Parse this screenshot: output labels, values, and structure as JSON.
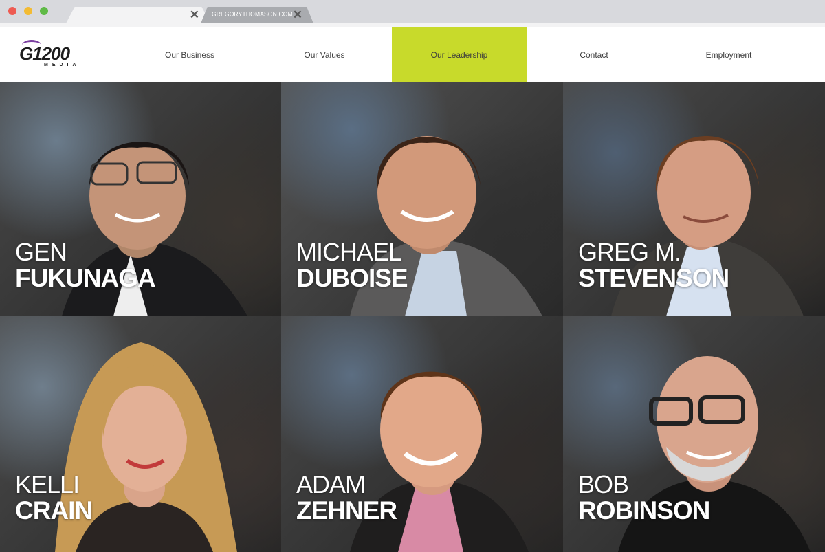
{
  "browser": {
    "active_tab_close": "✕",
    "inactive_tab_title": "GREGORYTHOMASON.COM",
    "inactive_tab_close": "✕"
  },
  "logo": {
    "main": "G1200",
    "sub": "MEDIA"
  },
  "nav": {
    "items": [
      {
        "label": "Our Business",
        "active": false
      },
      {
        "label": "Our Values",
        "active": false
      },
      {
        "label": "Our Leadership",
        "active": true
      },
      {
        "label": "Contact",
        "active": false
      },
      {
        "label": "Employment",
        "active": false
      }
    ],
    "accent_color": "#c8da2b"
  },
  "leaders": [
    {
      "first": "GEN",
      "last": "FUKUNAGA"
    },
    {
      "first": "MICHAEL",
      "last": "DUBOISE"
    },
    {
      "first": "GREG M.",
      "last": "STEVENSON"
    },
    {
      "first": "KELLI",
      "last": "CRAIN"
    },
    {
      "first": "ADAM",
      "last": "ZEHNER"
    },
    {
      "first": "BOB",
      "last": "ROBINSON"
    }
  ]
}
